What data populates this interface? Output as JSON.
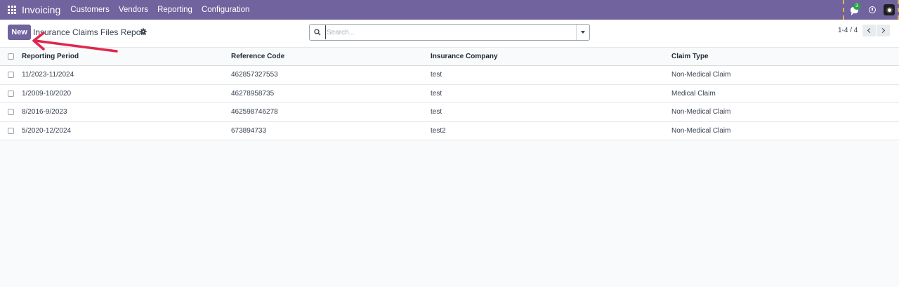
{
  "navbar": {
    "app_name": "Invoicing",
    "menu": [
      "Customers",
      "Vendors",
      "Reporting",
      "Configuration"
    ],
    "chat_badge": "3"
  },
  "control_panel": {
    "new_label": "New",
    "title": "Insurance Claims Files Report",
    "search_placeholder": "Search...",
    "pager": "1-4 / 4"
  },
  "table": {
    "columns": [
      "Reporting Period",
      "Reference Code",
      "Insurance Company",
      "Claim Type"
    ],
    "rows": [
      [
        "11/2023-11/2024",
        "462857327553",
        "test",
        "Non-Medical Claim"
      ],
      [
        "1/2009-10/2020",
        "46278958735",
        "test",
        "Medical Claim"
      ],
      [
        "8/2016-9/2023",
        "462598746278",
        "test",
        "Non-Medical Claim"
      ],
      [
        "5/2020-12/2024",
        "673894733",
        "test2",
        "Non-Medical Claim"
      ]
    ]
  },
  "colors": {
    "brand": "#71639e",
    "annotation_arrow": "#e0264d",
    "badge": "#28a745"
  },
  "icons": [
    "apps-grid-icon",
    "gear-icon",
    "search-icon",
    "chevron-down-icon",
    "chevron-left-icon",
    "chevron-right-icon",
    "chat-icon",
    "clock-icon",
    "avatar"
  ]
}
